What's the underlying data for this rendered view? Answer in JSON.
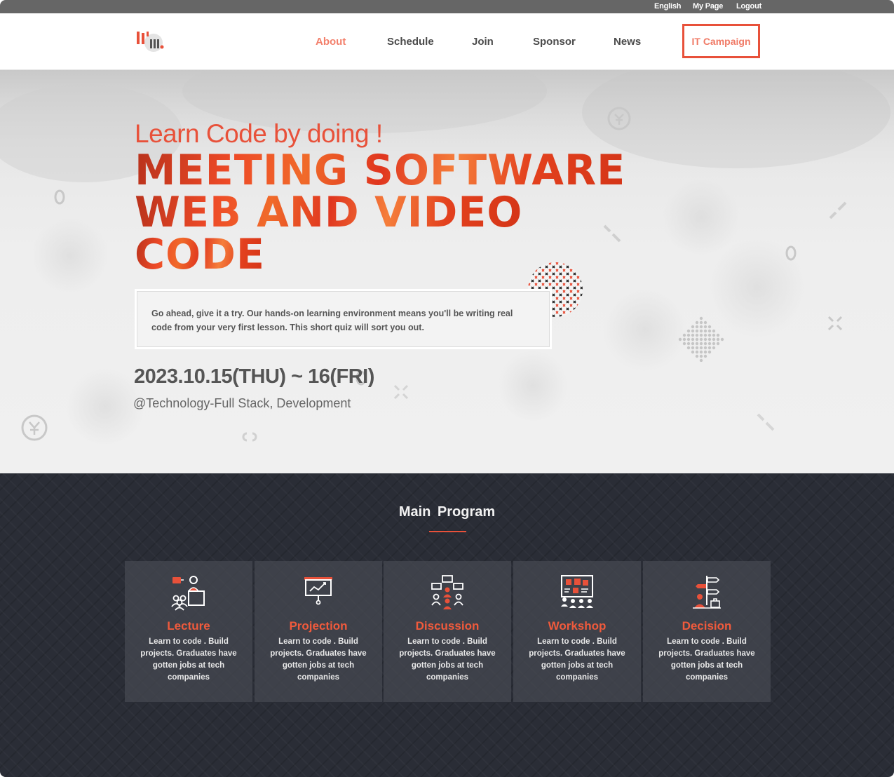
{
  "utility_nav": [
    "English",
    "My Page",
    "Logout"
  ],
  "nav": {
    "items": [
      "About",
      "Schedule",
      "Join",
      "Sponsor",
      "News"
    ],
    "active": "About",
    "cta": "IT Campaign"
  },
  "hero": {
    "tagline": "Learn Code by doing !",
    "headline": [
      "MEETING SOFTWARE",
      "WEB AND VIDEO",
      "CODE"
    ],
    "description": "Go ahead, give it a try. Our hands-on learning environment means you'll be writing real code from your very first lesson. This short quiz will sort you out.",
    "date": "2023.10.15(THU) ~ 16(FRI)",
    "venue": "@Technology-Full Stack, Development"
  },
  "program": {
    "title": "Main Program",
    "cards": [
      {
        "title": "Lecture",
        "icon": "lecture-icon",
        "desc": "Learn to code . Build projects. Graduates have gotten jobs at tech companies"
      },
      {
        "title": "Projection",
        "icon": "projection-icon",
        "desc": "Learn to code . Build projects. Graduates have gotten jobs at tech companies"
      },
      {
        "title": "Discussion",
        "icon": "discussion-icon",
        "desc": "Learn to code . Build projects. Graduates have gotten jobs at tech companies"
      },
      {
        "title": "Workshop",
        "icon": "workshop-icon",
        "desc": "Learn to code . Build projects. Graduates have gotten jobs at tech companies"
      },
      {
        "title": "Decision",
        "icon": "decision-icon",
        "desc": "Learn to code . Build projects. Graduates have gotten jobs at tech companies"
      }
    ]
  },
  "colors": {
    "accent": "#e8513a",
    "nav_active": "#f3806c",
    "dark_bg": "#2a2d36",
    "topbar": "#666666"
  }
}
